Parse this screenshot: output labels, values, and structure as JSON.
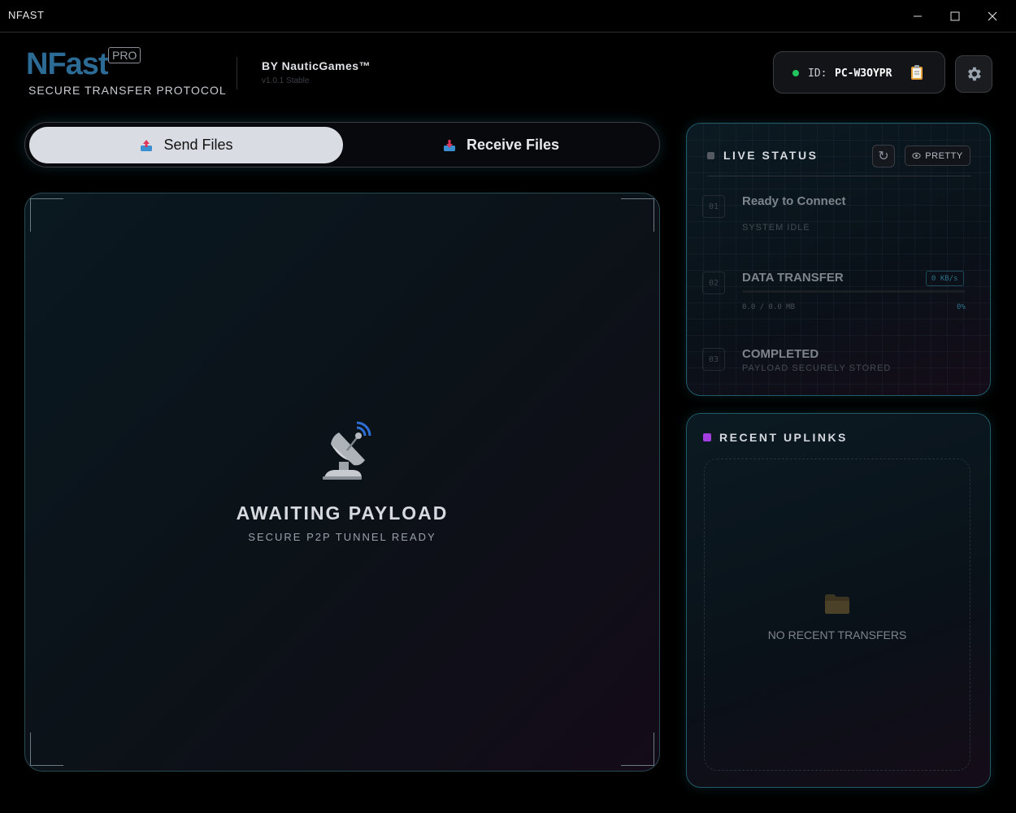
{
  "window": {
    "title": "NFAST"
  },
  "header": {
    "logo": "NFast",
    "badge": "PRO",
    "subtitle": "SECURE TRANSFER PROTOCOL",
    "by": "BY NauticGames™",
    "version": "v1.0.1 Stable",
    "id_label": "ID:",
    "id_value": "PC-W3OYPR"
  },
  "tabs": [
    {
      "label": "Send Files",
      "active": true
    },
    {
      "label": "Receive Files",
      "active": false
    }
  ],
  "dropzone": {
    "title": "AWAITING PAYLOAD",
    "subtitle": "SECURE P2P TUNNEL READY",
    "icon": "satellite-dish-icon"
  },
  "live_status": {
    "title": "LIVE STATUS",
    "pretty_label": "PRETTY",
    "steps": [
      {
        "num": "01",
        "title": "Ready to Connect",
        "sub": "SYSTEM IDLE"
      },
      {
        "num": "02",
        "title": "DATA TRANSFER",
        "speed": "0 KB/s",
        "size": "0.0 / 0.0 MB",
        "percent": "0%",
        "progress": 0
      },
      {
        "num": "03",
        "title": "COMPLETED",
        "sub": "PAYLOAD SECURELY STORED"
      }
    ]
  },
  "recent_uplinks": {
    "title": "RECENT UPLINKS",
    "empty_text": "NO RECENT TRANSFERS"
  },
  "colors": {
    "accent": "#2b6b96",
    "status_online": "#21c45d",
    "uplinks_marker": "#a23de0",
    "panel_border": "#1f5a66"
  }
}
